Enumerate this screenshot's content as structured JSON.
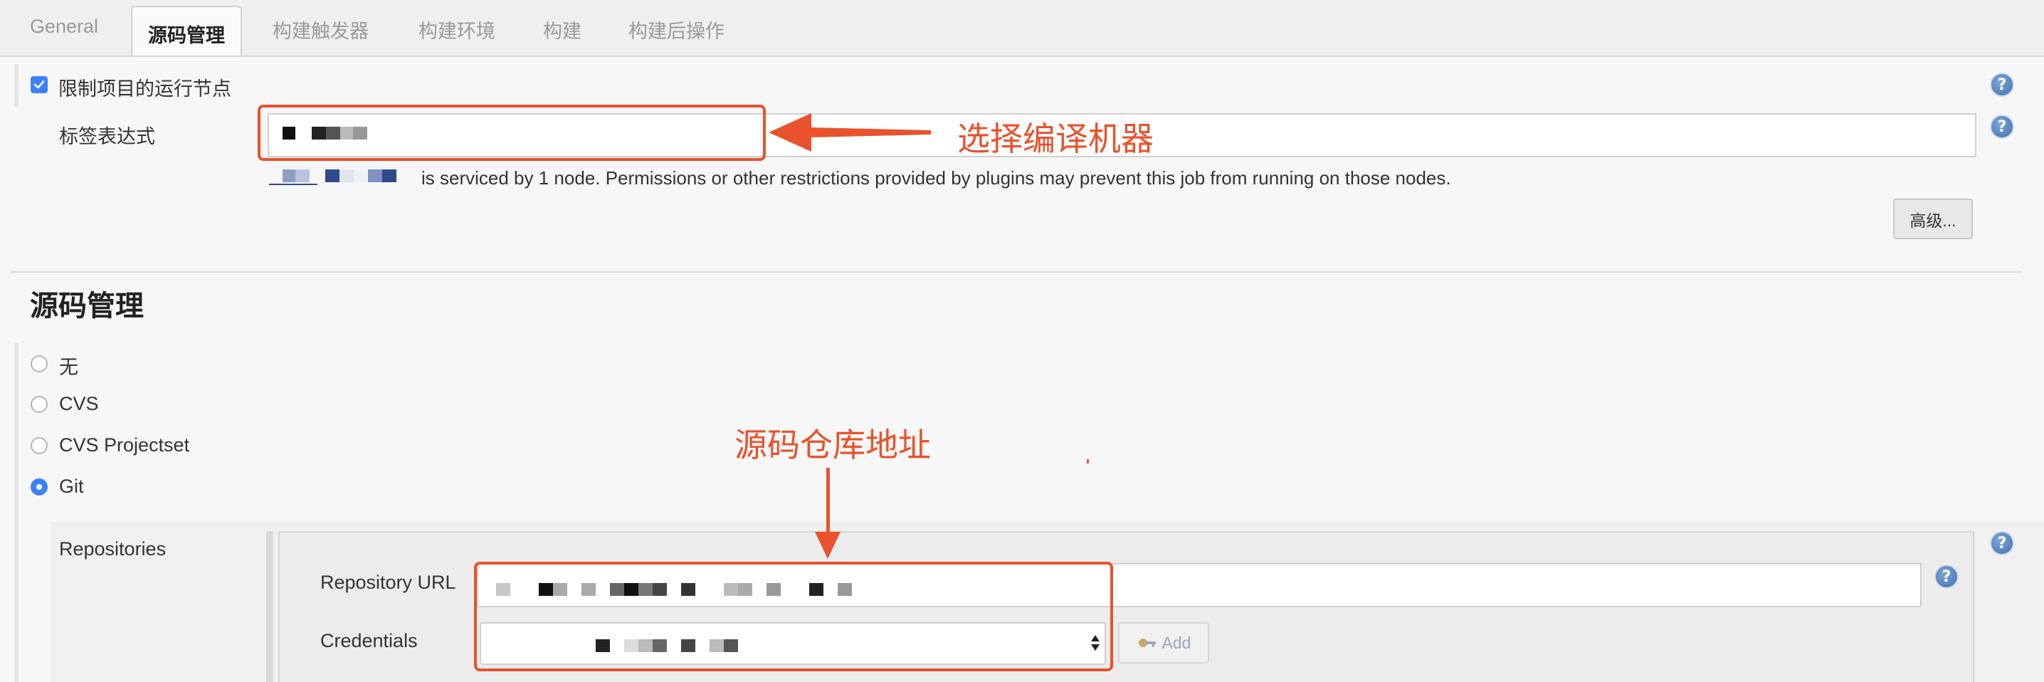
{
  "tabs": [
    {
      "label": "General"
    },
    {
      "label": "源码管理",
      "active": true
    },
    {
      "label": "构建触发器"
    },
    {
      "label": "构建环境"
    },
    {
      "label": "构建"
    },
    {
      "label": "构建后操作"
    }
  ],
  "restrict_node": {
    "checkbox_label": "限制项目的运行节点",
    "checked": true,
    "label_expression_label": "标签表达式",
    "info_text": "is serviced by 1 node. Permissions or other restrictions provided by plugins may prevent this job from running on those nodes.",
    "advanced_button": "高级..."
  },
  "scm": {
    "section_title": "源码管理",
    "options": [
      {
        "label": "无",
        "selected": false
      },
      {
        "label": "CVS",
        "selected": false
      },
      {
        "label": "CVS Projectset",
        "selected": false
      },
      {
        "label": "Git",
        "selected": true
      }
    ],
    "repositories_label": "Repositories",
    "repository_url_label": "Repository URL",
    "credentials_label": "Credentials",
    "add_button": "Add"
  },
  "annotations": {
    "compile_machine": "选择编译机器",
    "repo_address": "源码仓库地址"
  },
  "colors": {
    "annotation": "#e8522c",
    "accent": "#3b82f6",
    "help_icon": "#4a78b8"
  }
}
